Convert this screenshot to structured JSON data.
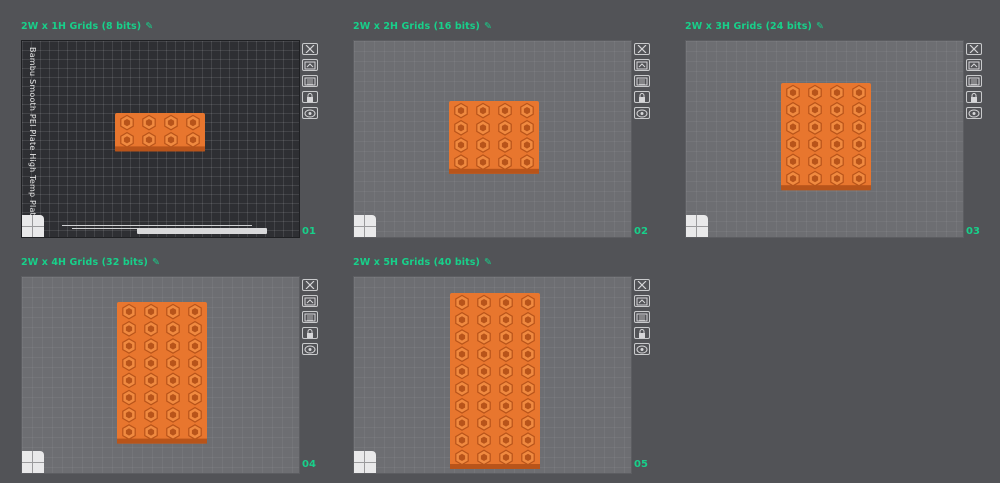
{
  "plates": [
    {
      "title": "2W x 1H Grids (8 bits)",
      "index": "01",
      "rows": 2,
      "cols": 4,
      "textured": true,
      "plate_label": "Bambu Smooth PEI Plate High Temp Plate"
    },
    {
      "title": "2W x 2H Grids (16 bits)",
      "index": "02",
      "rows": 4,
      "cols": 4,
      "textured": false
    },
    {
      "title": "2W x 3H Grids (24 bits)",
      "index": "03",
      "rows": 6,
      "cols": 4,
      "textured": false
    },
    {
      "title": "2W x 4H Grids (32 bits)",
      "index": "04",
      "rows": 8,
      "cols": 4,
      "textured": false
    },
    {
      "title": "2W x 5H Grids (40 bits)",
      "index": "05",
      "rows": 10,
      "cols": 4,
      "textured": false
    }
  ],
  "tools": [
    {
      "icon": "close-icon"
    },
    {
      "icon": "auto-orient-icon"
    },
    {
      "icon": "arrange-icon"
    },
    {
      "icon": "lock-icon"
    },
    {
      "icon": "plate-settings-icon"
    }
  ],
  "colors": {
    "background": "#525357",
    "accent": "#18d08a",
    "model": "#e8762e",
    "model_dark": "#b8541a"
  }
}
